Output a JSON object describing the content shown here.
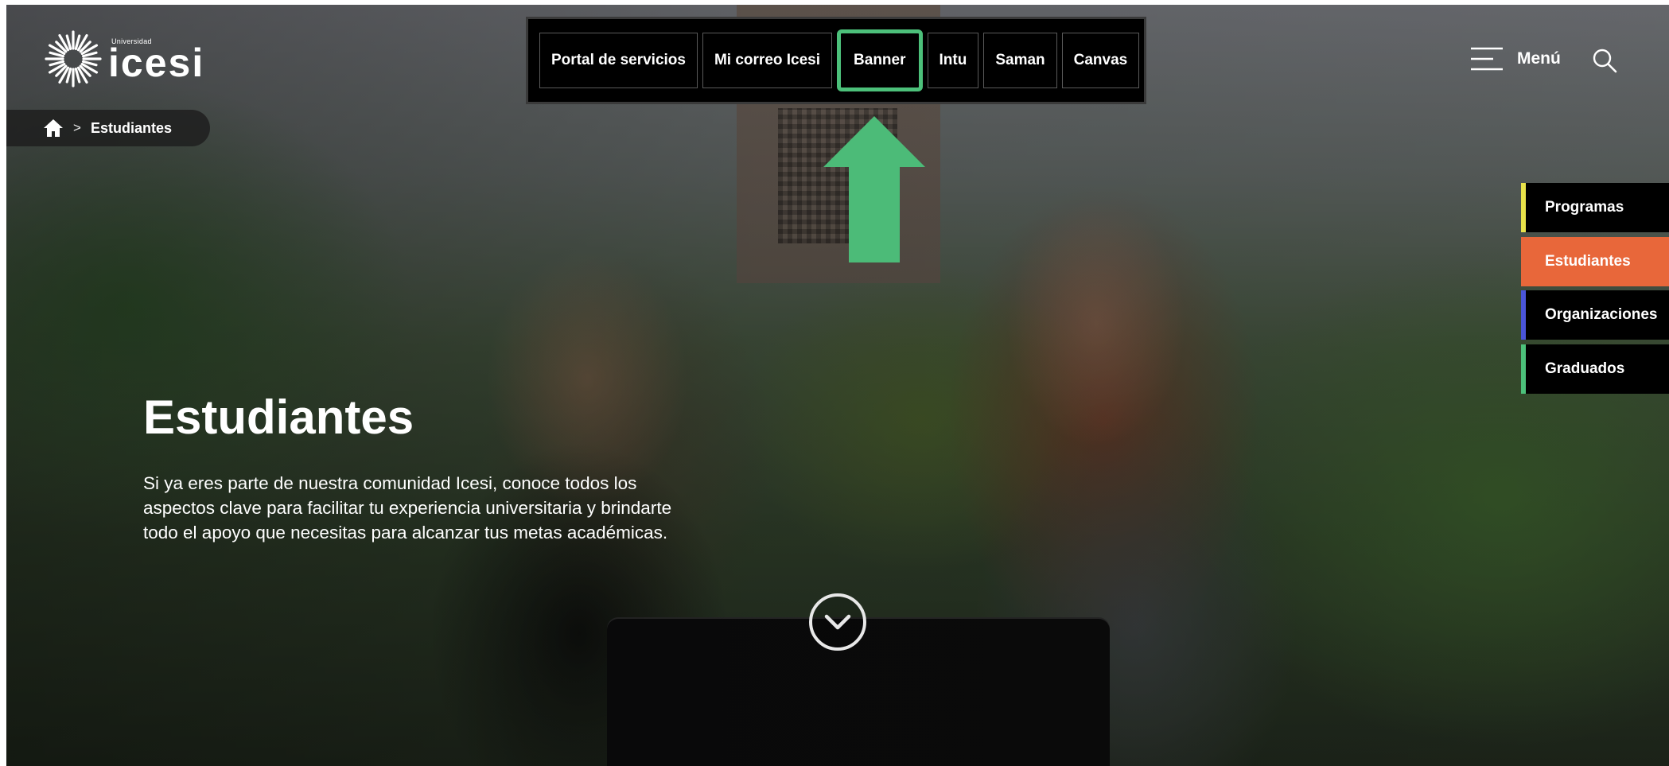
{
  "brand": {
    "small_text": "Universidad",
    "name": "icesi"
  },
  "quick_links": [
    {
      "label": "Portal de servicios",
      "active": false
    },
    {
      "label": "Mi correo Icesi",
      "active": false
    },
    {
      "label": "Banner",
      "active": true
    },
    {
      "label": "Intu",
      "active": false
    },
    {
      "label": "Saman",
      "active": false
    },
    {
      "label": "Canvas",
      "active": false
    }
  ],
  "header": {
    "menu_label": "Menú"
  },
  "breadcrumb": {
    "separator": ">",
    "current": "Estudiantes"
  },
  "side_tabs": [
    {
      "label": "Programas",
      "accent": "#e8e24a",
      "active": false
    },
    {
      "label": "Estudiantes",
      "accent": "#e8673a",
      "active": true
    },
    {
      "label": "Organizaciones",
      "accent": "#4a55d8",
      "active": false
    },
    {
      "label": "Graduados",
      "accent": "#4cc07a",
      "active": false
    }
  ],
  "hero": {
    "title": "Estudiantes",
    "description": "Si ya eres parte de nuestra comunidad Icesi, conoce todos los aspectos clave para facilitar tu experiencia universitaria y brindarte todo el apoyo que necesitas para alcanzar tus metas académicas."
  },
  "annotation": {
    "color": "#4cc07a",
    "target": "Banner"
  },
  "icons": [
    "home-icon",
    "hamburger-menu-icon",
    "search-icon",
    "chevron-down-icon",
    "up-arrow-icon"
  ]
}
